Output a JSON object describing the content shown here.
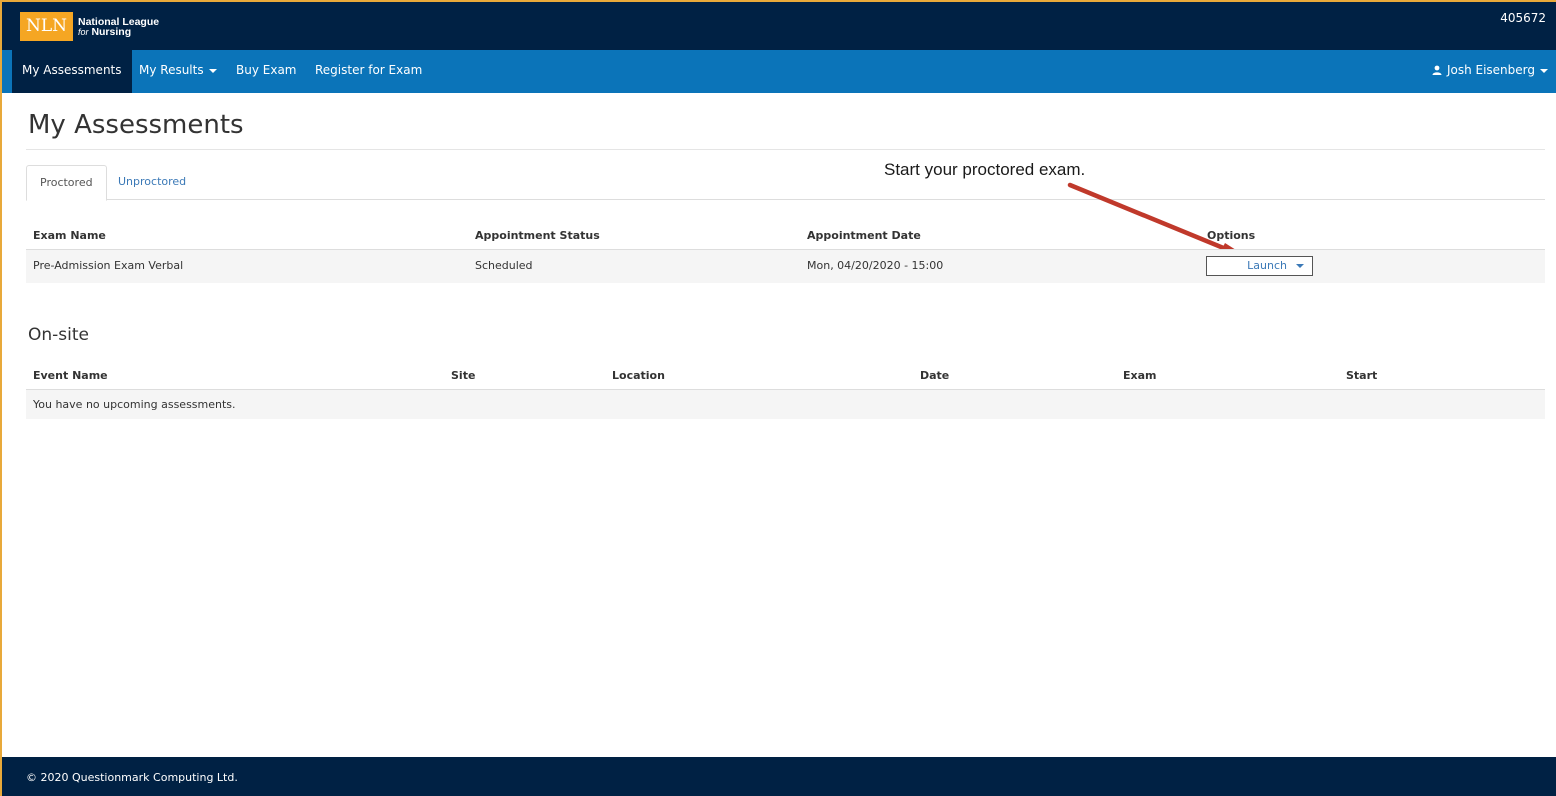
{
  "header": {
    "logo_mark": "NLN",
    "logo_line1": "National League",
    "logo_line2_for": "for",
    "logo_line2_nursing": "Nursing",
    "account_id": "405672"
  },
  "nav": {
    "items": [
      {
        "label": "My Assessments",
        "active": true
      },
      {
        "label": "My Results",
        "dropdown": true
      },
      {
        "label": "Buy Exam"
      },
      {
        "label": "Register for Exam"
      }
    ],
    "user_name": "Josh Eisenberg",
    "user_icon": "user-icon"
  },
  "page": {
    "title": "My Assessments",
    "tabs": [
      "Proctored",
      "Unproctored"
    ],
    "active_tab": "Proctored"
  },
  "annotation": {
    "text": "Start your proctored exam.",
    "arrow_color": "#c0392b"
  },
  "proctored_table": {
    "headers": [
      "Exam Name",
      "Appointment Status",
      "Appointment Date",
      "Options"
    ],
    "rows": [
      {
        "exam_name": "Pre-Admission Exam Verbal",
        "status": "Scheduled",
        "date": "Mon, 04/20/2020 - 15:00",
        "option": "Launch"
      }
    ]
  },
  "onsite": {
    "title": "On-site",
    "headers": [
      "Event Name",
      "Site",
      "Location",
      "Date",
      "Exam",
      "Start"
    ],
    "empty_message": "You have no upcoming assessments."
  },
  "footer": {
    "text": "© 2020 Questionmark Computing Ltd."
  },
  "colors": {
    "header_bg": "#002144",
    "nav_bg": "#0b74b9",
    "logo_bg": "#f5a623",
    "link": "#3b79b7"
  }
}
